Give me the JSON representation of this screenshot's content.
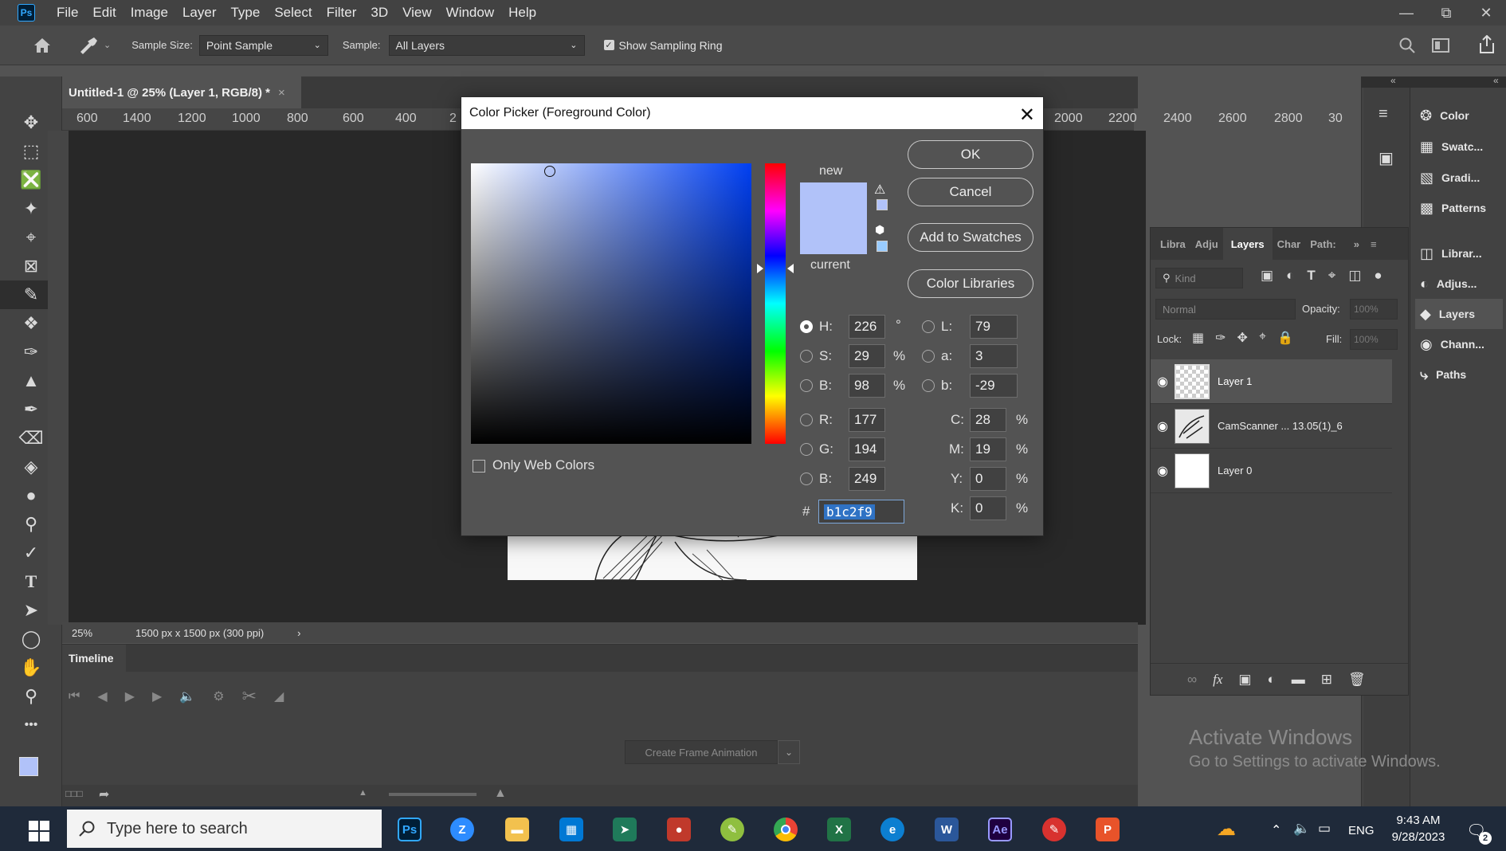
{
  "app": {
    "logo": "Ps",
    "menus": [
      "File",
      "Edit",
      "Image",
      "Layer",
      "Type",
      "Select",
      "Filter",
      "3D",
      "View",
      "Window",
      "Help"
    ]
  },
  "options_bar": {
    "sample_size_label": "Sample Size:",
    "sample_size_value": "Point Sample",
    "sample_label": "Sample:",
    "sample_value": "All Layers",
    "show_sampling_ring": "Show Sampling Ring"
  },
  "document": {
    "tab_title": "Untitled-1 @ 25% (Layer 1, RGB/8) *",
    "ruler_left_labels": [
      "600",
      "1400",
      "1200",
      "1000",
      "800",
      "600",
      "400",
      "2"
    ],
    "ruler_right_labels": [
      "2000",
      "2200",
      "2400",
      "2600",
      "2800",
      "30"
    ],
    "zoom": "25%",
    "doc_info": "1500 px x 1500 px (300 ppi)"
  },
  "timeline": {
    "tab": "Timeline",
    "create_frame_animation": "Create Frame Animation"
  },
  "color_picker": {
    "title": "Color Picker (Foreground Color)",
    "new_label": "new",
    "current_label": "current",
    "buttons": {
      "ok": "OK",
      "cancel": "Cancel",
      "add_to_swatches": "Add to Swatches",
      "color_libraries": "Color Libraries"
    },
    "only_web_colors": "Only Web Colors",
    "hsb": {
      "h_label": "H:",
      "h": "226",
      "h_unit": "°",
      "s_label": "S:",
      "s": "29",
      "s_unit": "%",
      "b_label": "B:",
      "b": "98",
      "b_unit": "%"
    },
    "lab": {
      "l_label": "L:",
      "l": "79",
      "a_label": "a:",
      "a": "3",
      "b_label": "b:",
      "b": "-29"
    },
    "rgb": {
      "r_label": "R:",
      "r": "177",
      "g_label": "G:",
      "g": "194",
      "b_label": "B:",
      "b": "249"
    },
    "cmyk": {
      "c_label": "C:",
      "c": "28",
      "c_unit": "%",
      "m_label": "M:",
      "m": "19",
      "m_unit": "%",
      "y_label": "Y:",
      "y": "0",
      "y_unit": "%",
      "k_label": "K:",
      "k": "0",
      "k_unit": "%"
    },
    "hex_label": "#",
    "hex": "b1c2f9",
    "selected_color": "#b1c2f9"
  },
  "layers_panel": {
    "tabs": [
      "Libra",
      "Adju",
      "Layers",
      "Char",
      "Path:"
    ],
    "filter_placeholder": "Kind",
    "blend_mode": "Normal",
    "opacity_label": "Opacity:",
    "opacity_value": "100%",
    "lock_label": "Lock:",
    "fill_label": "Fill:",
    "fill_value": "100%",
    "layers": [
      {
        "name": "Layer 1"
      },
      {
        "name": "CamScanner ... 13.05(1)_6"
      },
      {
        "name": "Layer 0"
      }
    ]
  },
  "right_panels": {
    "items": [
      "Color",
      "Swatc...",
      "Gradi...",
      "Patterns",
      "Librar...",
      "Adjus...",
      "Layers",
      "Chann...",
      "Paths"
    ]
  },
  "watermark": {
    "line1": "Activate Windows",
    "line2": "Go to Settings to activate Windows."
  },
  "taskbar": {
    "search_placeholder": "Type here to search",
    "language": "ENG",
    "time": "9:43 AM",
    "date": "9/28/2023",
    "notification_count": "2"
  }
}
